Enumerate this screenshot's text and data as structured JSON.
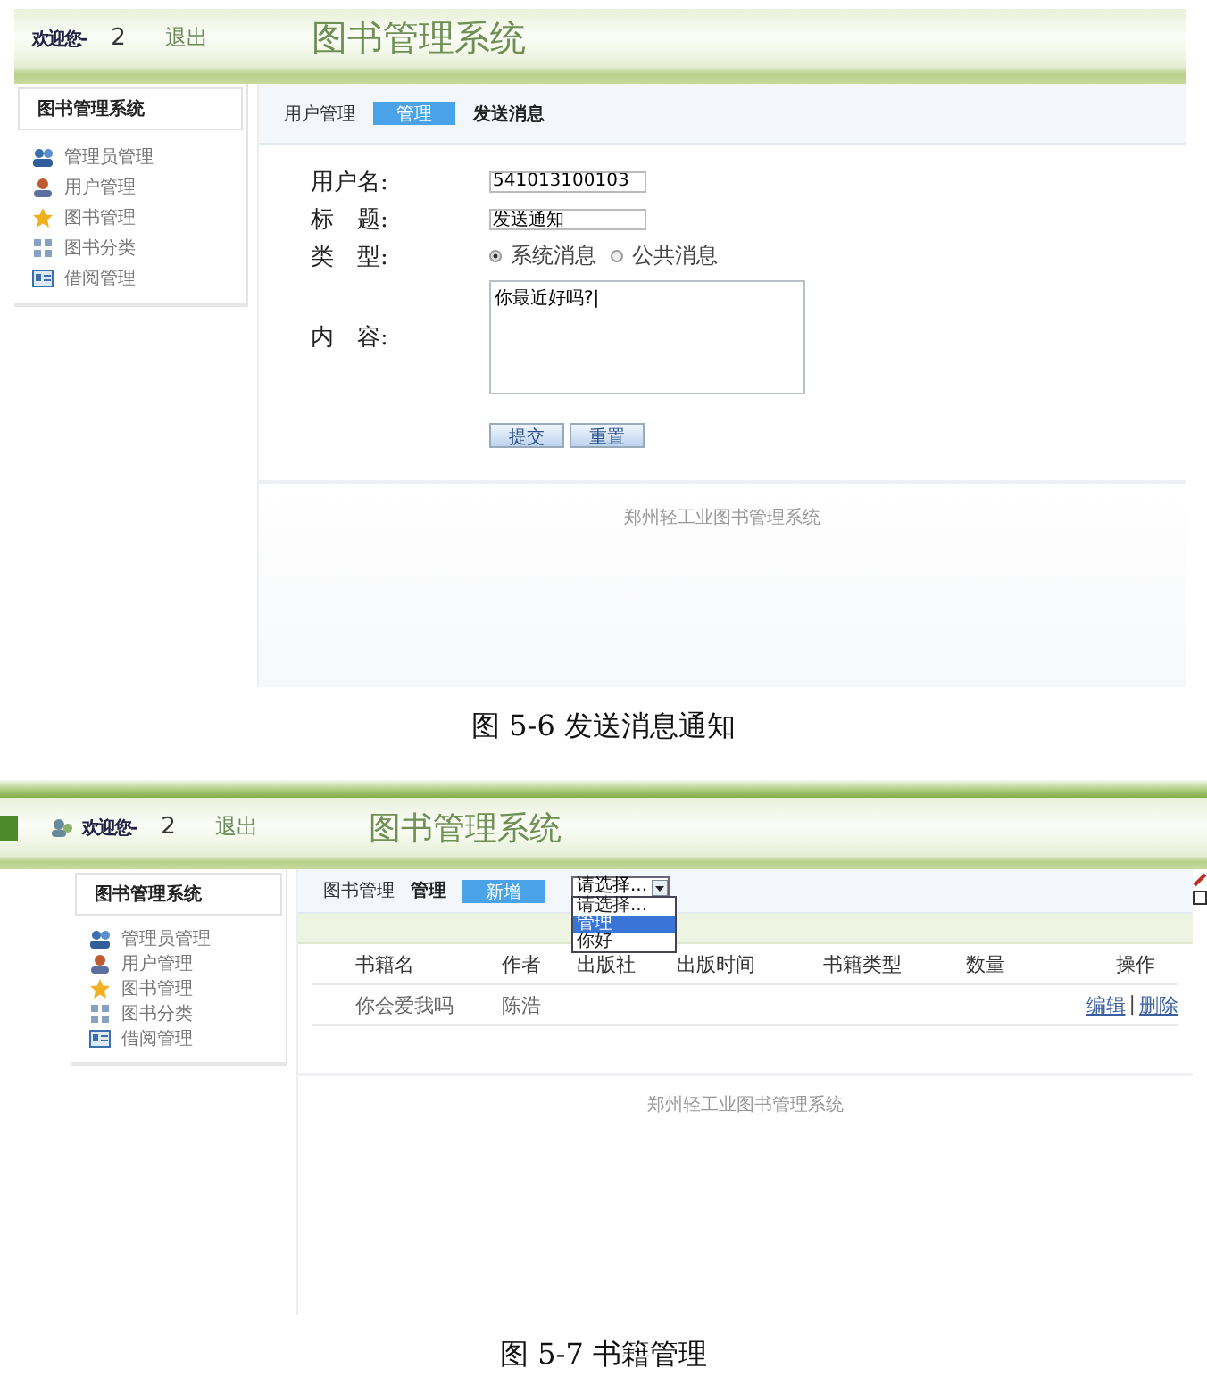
{
  "figures": [
    {
      "kind": "message_form",
      "header": {
        "welcome": "欢迎您-",
        "user": "2",
        "logout": "退出",
        "title": "图书管理系统"
      },
      "sidebar": {
        "title": "图书管理系统",
        "items": [
          {
            "label": "管理员管理"
          },
          {
            "label": "用户管理"
          },
          {
            "label": "图书管理"
          },
          {
            "label": "图书分类"
          },
          {
            "label": "借阅管理"
          }
        ]
      },
      "breadcrumb": [
        {
          "label": "用户管理",
          "kind": "text"
        },
        {
          "label": "管理",
          "kind": "button"
        },
        {
          "label": "发送消息",
          "kind": "bold"
        }
      ],
      "form": {
        "fields": [
          {
            "label": "用户名:",
            "kind": "text",
            "value": "541013100103"
          },
          {
            "label": "标　题:",
            "kind": "text",
            "value": "发送通知"
          },
          {
            "label": "类　型:",
            "kind": "radio",
            "options": [
              {
                "label": "系统消息",
                "selected": true
              },
              {
                "label": "公共消息",
                "selected": false
              }
            ]
          },
          {
            "label": "内　容:",
            "kind": "textarea",
            "value": "你最近好吗?|"
          }
        ],
        "buttons": [
          "提交",
          "重置"
        ]
      },
      "footer": "郑州轻工业图书管理系统",
      "caption": "图 5-6 发送消息通知"
    },
    {
      "kind": "book_list",
      "header": {
        "welcome": "欢迎您-",
        "user": "2",
        "logout": "退出",
        "title": "图书管理系统"
      },
      "sidebar": {
        "title": "图书管理系统",
        "items": [
          {
            "label": "管理员管理"
          },
          {
            "label": "用户管理"
          },
          {
            "label": "图书管理"
          },
          {
            "label": "图书分类"
          },
          {
            "label": "借阅管理"
          }
        ]
      },
      "breadcrumb": [
        {
          "label": "图书管理",
          "kind": "text"
        },
        {
          "label": "管理",
          "kind": "bold"
        },
        {
          "label": "新增",
          "kind": "button"
        }
      ],
      "select": {
        "value": "请选择...",
        "expanded": true,
        "options": [
          {
            "label": "请选择...",
            "highlighted": false
          },
          {
            "label": "管理",
            "highlighted": true
          },
          {
            "label": "你好",
            "highlighted": false
          }
        ]
      },
      "table": {
        "columns": [
          "书籍名",
          "作者",
          "出版社",
          "出版时间",
          "书籍类型",
          "数量",
          "操作"
        ],
        "rows": [
          {
            "name": "你会爱我吗",
            "author": "陈浩",
            "actions": [
              "编辑",
              "删除"
            ],
            "separator": "|"
          }
        ]
      },
      "footer": "郑州轻工业图书管理系统",
      "caption": "图 5-7 书籍管理"
    }
  ]
}
